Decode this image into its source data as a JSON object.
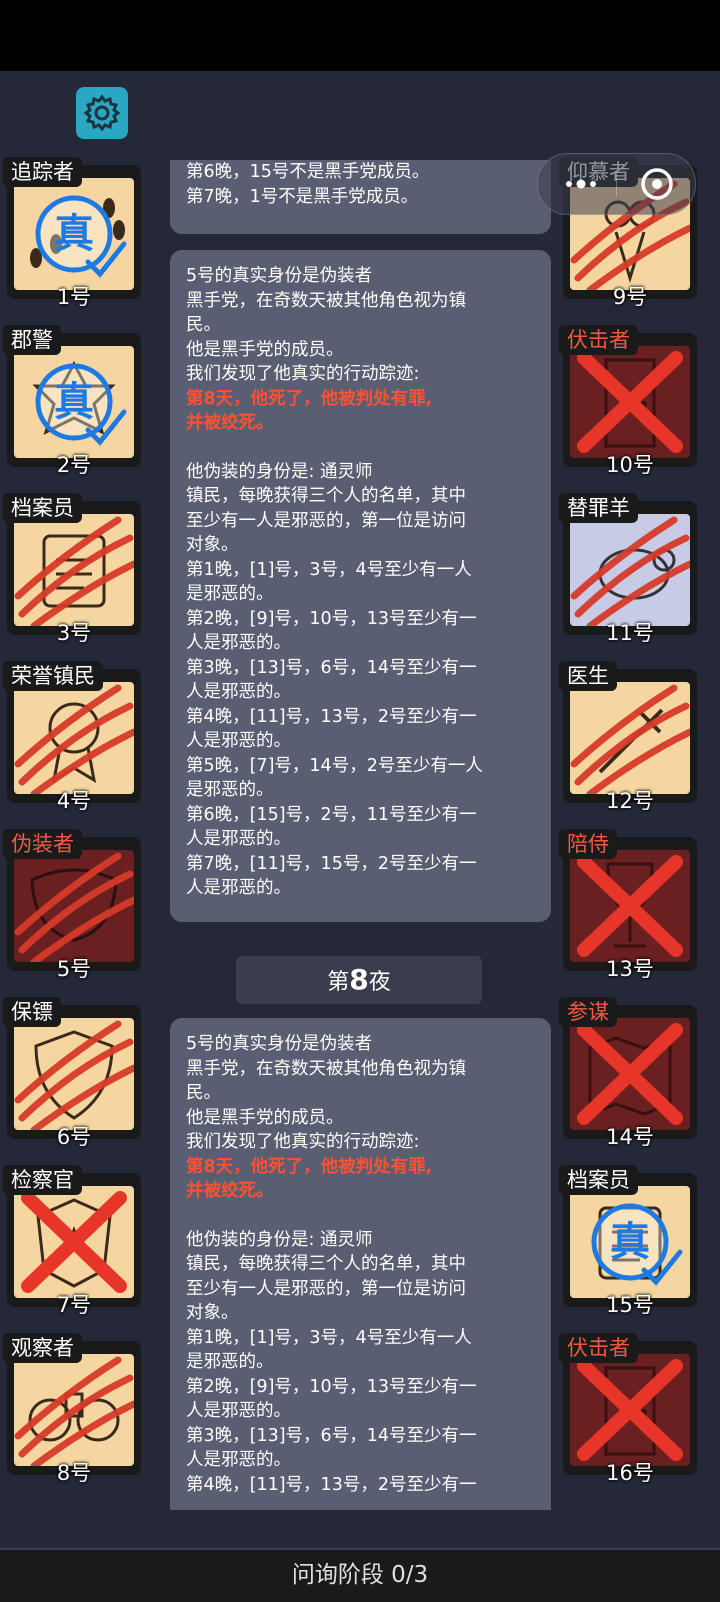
{
  "header": {
    "settings_icon": "gear-icon",
    "menu_icon": "more-dots-icon",
    "close_icon": "target-close-icon"
  },
  "players": [
    {
      "num": "1号",
      "role": "追踪者",
      "team": "town",
      "status": "verified",
      "icon": "footprints-icon"
    },
    {
      "num": "2号",
      "role": "郡警",
      "team": "town",
      "status": "verified",
      "icon": "sheriff-badge-icon"
    },
    {
      "num": "3号",
      "role": "档案员",
      "team": "town",
      "status": "slashed",
      "icon": "archive-icon"
    },
    {
      "num": "4号",
      "role": "荣誉镇民",
      "team": "town",
      "status": "slashed",
      "icon": "medal-icon"
    },
    {
      "num": "5号",
      "role": "伪装者",
      "team": "evil",
      "status": "slashed",
      "icon": "mask-icon"
    },
    {
      "num": "6号",
      "role": "保镖",
      "team": "town",
      "status": "slashed",
      "icon": "shield-icon"
    },
    {
      "num": "7号",
      "role": "检察官",
      "team": "town",
      "status": "crossed",
      "icon": "police-badge-icon"
    },
    {
      "num": "8号",
      "role": "观察者",
      "team": "town",
      "status": "slashed",
      "icon": "binoculars-icon"
    },
    {
      "num": "9号",
      "role": "仰慕者",
      "team": "town",
      "status": "slashed",
      "icon": "bouquet-icon"
    },
    {
      "num": "10号",
      "role": "伏击者",
      "team": "evil",
      "status": "crossed",
      "icon": "door-icon"
    },
    {
      "num": "11号",
      "role": "替罪羊",
      "team": "neutral",
      "status": "slashed",
      "icon": "sheep-icon"
    },
    {
      "num": "12号",
      "role": "医生",
      "team": "town",
      "status": "slashed",
      "icon": "syringe-icon"
    },
    {
      "num": "13号",
      "role": "陪侍",
      "team": "evil",
      "status": "crossed",
      "icon": "wine-glass-icon"
    },
    {
      "num": "14号",
      "role": "参谋",
      "team": "evil",
      "status": "crossed",
      "icon": "map-icon"
    },
    {
      "num": "15号",
      "role": "档案员",
      "team": "town",
      "status": "verified",
      "icon": "archive-icon"
    },
    {
      "num": "16号",
      "role": "伏击者",
      "team": "evil",
      "status": "crossed",
      "icon": "door-icon"
    }
  ],
  "verified_stamp": "真",
  "log": {
    "bubble1": {
      "line1": "第6晚，15号不是黑手党成员。",
      "line2": "第7晚，1号不是黑手党成员。"
    },
    "bubble2": {
      "lines_a": [
        "5号的真实身份是伪装者",
        "黑手党，在奇数天被其他角色视为镇",
        "民。",
        "他是黑手党的成员。",
        "我们发现了他真实的行动踪迹:"
      ],
      "red": [
        "第8天，他死了，他被判处有罪,",
        "并被绞死。"
      ],
      "lines_b": [
        "他伪装的身份是: 通灵师",
        "镇民，每晚获得三个人的名单，其中",
        "至少有一人是邪恶的，第一位是访问",
        "对象。",
        "第1晚，[1]号，3号，4号至少有一人",
        "是邪恶的。",
        "第2晚，[9]号，10号，13号至少有一",
        "人是邪恶的。",
        "第3晚，[13]号，6号，14号至少有一",
        "人是邪恶的。",
        "第4晚，[11]号，13号，2号至少有一",
        "人是邪恶的。",
        "第5晚，[7]号，14号，2号至少有一人",
        "是邪恶的。",
        "第6晚，[15]号，2号，11号至少有一",
        "人是邪恶的。",
        "第7晚，[11]号，15号，2号至少有一",
        "人是邪恶的。"
      ]
    },
    "night_label_prefix": "第",
    "night_number": "8",
    "night_label_suffix": "夜",
    "bubble3": {
      "lines_a": [
        "5号的真实身份是伪装者",
        "黑手党，在奇数天被其他角色视为镇",
        "民。",
        "他是黑手党的成员。",
        "我们发现了他真实的行动踪迹:"
      ],
      "red": [
        "第8天，他死了，他被判处有罪,",
        "并被绞死。"
      ],
      "lines_b": [
        "他伪装的身份是: 通灵师",
        "镇民，每晚获得三个人的名单，其中",
        "至少有一人是邪恶的，第一位是访问",
        "对象。",
        "第1晚，[1]号，3号，4号至少有一人",
        "是邪恶的。",
        "第2晚，[9]号，10号，13号至少有一",
        "人是邪恶的。",
        "第3晚，[13]号，6号，14号至少有一",
        "人是邪恶的。",
        "第4晚，[11]号，13号，2号至少有一"
      ]
    }
  },
  "footer": {
    "phase_label": "问询阶段 0/3"
  },
  "colors": {
    "town": "#f5d6a0",
    "evil": "#6a2020",
    "neutral": "#c8cbe6",
    "cross": "#e8352a",
    "verified": "#1e7ae0",
    "accent_red": "#ff5131"
  }
}
